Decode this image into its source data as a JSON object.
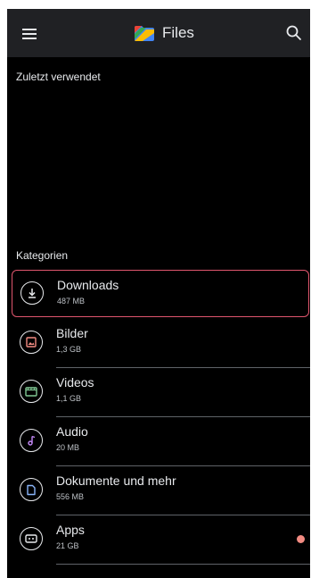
{
  "appbar": {
    "title": "Files"
  },
  "recent": {
    "label": "Zuletzt verwendet"
  },
  "categories": {
    "label": "Kategorien",
    "items": [
      {
        "name": "Downloads",
        "size": "487 MB",
        "icon": "download-icon",
        "highlighted": true
      },
      {
        "name": "Bilder",
        "size": "1,3 GB",
        "icon": "image-icon"
      },
      {
        "name": "Videos",
        "size": "1,1 GB",
        "icon": "video-icon"
      },
      {
        "name": "Audio",
        "size": "20 MB",
        "icon": "music-note-icon"
      },
      {
        "name": "Dokumente und mehr",
        "size": "556 MB",
        "icon": "document-icon"
      },
      {
        "name": "Apps",
        "size": "21 GB",
        "icon": "apps-icon",
        "badge": true
      }
    ]
  },
  "colors": {
    "background": "#000000",
    "appbar": "#202124",
    "highlight_border": "#e0566e",
    "badge": "#f28b82"
  }
}
